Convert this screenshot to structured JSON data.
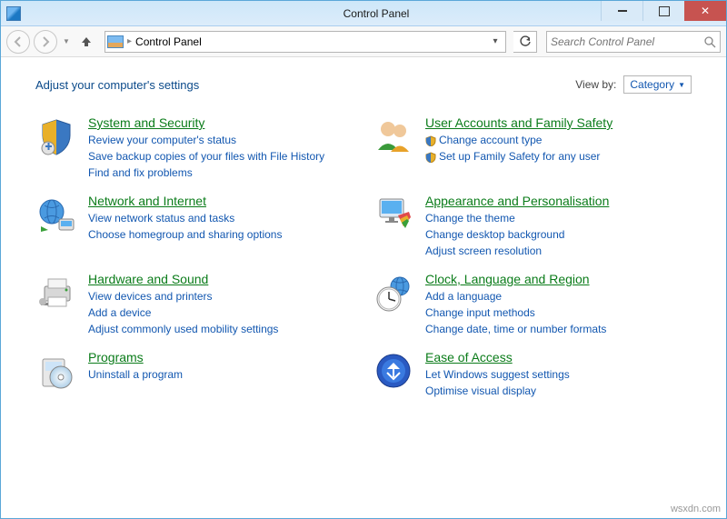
{
  "window": {
    "title": "Control Panel"
  },
  "nav": {
    "breadcrumb": "Control Panel",
    "search_placeholder": "Search Control Panel"
  },
  "header": {
    "heading": "Adjust your computer's settings",
    "viewby_label": "View by:",
    "viewby_value": "Category"
  },
  "categories": [
    {
      "icon": "shield",
      "title": "System and Security",
      "links": [
        "Review your computer's status",
        "Save backup copies of your files with File History",
        "Find and fix problems"
      ]
    },
    {
      "icon": "users",
      "title": "User Accounts and Family Safety",
      "links": [
        "Change account type",
        "Set up Family Safety for any user"
      ],
      "badges": true
    },
    {
      "icon": "globe-net",
      "title": "Network and Internet",
      "links": [
        "View network status and tasks",
        "Choose homegroup and sharing options"
      ]
    },
    {
      "icon": "appearance",
      "title": "Appearance and Personalisation",
      "links": [
        "Change the theme",
        "Change desktop background",
        "Adjust screen resolution"
      ]
    },
    {
      "icon": "printer",
      "title": "Hardware and Sound",
      "links": [
        "View devices and printers",
        "Add a device",
        "Adjust commonly used mobility settings"
      ]
    },
    {
      "icon": "clock",
      "title": "Clock, Language and Region",
      "links": [
        "Add a language",
        "Change input methods",
        "Change date, time or number formats"
      ]
    },
    {
      "icon": "disc",
      "title": "Programs",
      "links": [
        "Uninstall a program"
      ]
    },
    {
      "icon": "ease",
      "title": "Ease of Access",
      "links": [
        "Let Windows suggest settings",
        "Optimise visual display"
      ]
    }
  ],
  "watermark": "wsxdn.com"
}
